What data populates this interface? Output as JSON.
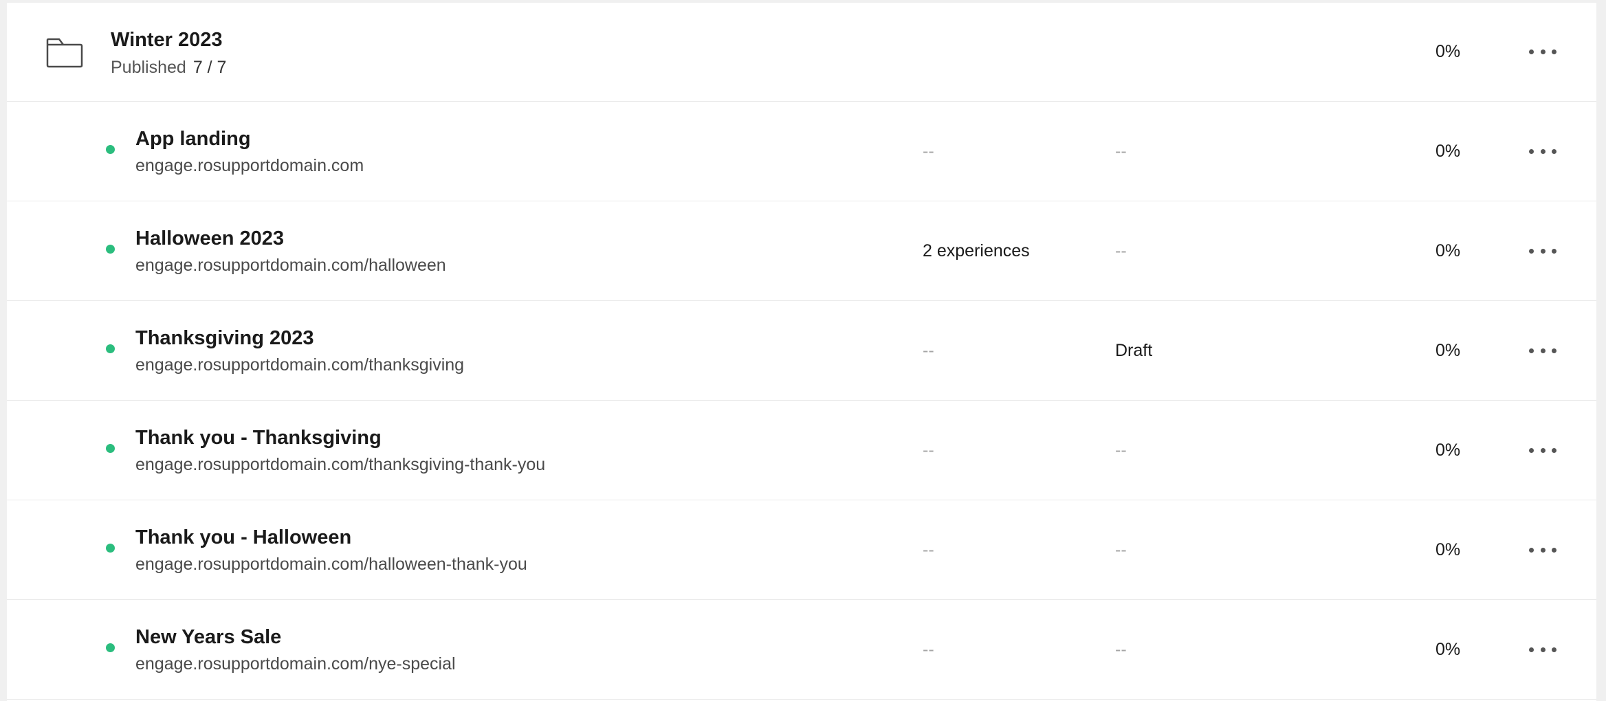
{
  "group": {
    "title": "Winter 2023",
    "status_label": "Published",
    "count": "7 / 7",
    "percent": "0%",
    "icon": "folder-icon"
  },
  "pages": [
    {
      "title": "App landing",
      "url": "engage.rosupportdomain.com",
      "experiences": "--",
      "state": "--",
      "percent": "0%",
      "status_color": "#2bbd7e"
    },
    {
      "title": "Halloween 2023",
      "url": "engage.rosupportdomain.com/halloween",
      "experiences": "2 experiences",
      "state": "--",
      "percent": "0%",
      "status_color": "#2bbd7e"
    },
    {
      "title": "Thanksgiving 2023",
      "url": "engage.rosupportdomain.com/thanksgiving",
      "experiences": "--",
      "state": "Draft",
      "percent": "0%",
      "status_color": "#2bbd7e"
    },
    {
      "title": "Thank you - Thanksgiving",
      "url": "engage.rosupportdomain.com/thanksgiving-thank-you",
      "experiences": "--",
      "state": "--",
      "percent": "0%",
      "status_color": "#2bbd7e"
    },
    {
      "title": "Thank you - Halloween",
      "url": "engage.rosupportdomain.com/halloween-thank-you",
      "experiences": "--",
      "state": "--",
      "percent": "0%",
      "status_color": "#2bbd7e"
    },
    {
      "title": "New Years Sale",
      "url": "engage.rosupportdomain.com/nye-special",
      "experiences": "--",
      "state": "--",
      "percent": "0%",
      "status_color": "#2bbd7e"
    }
  ]
}
